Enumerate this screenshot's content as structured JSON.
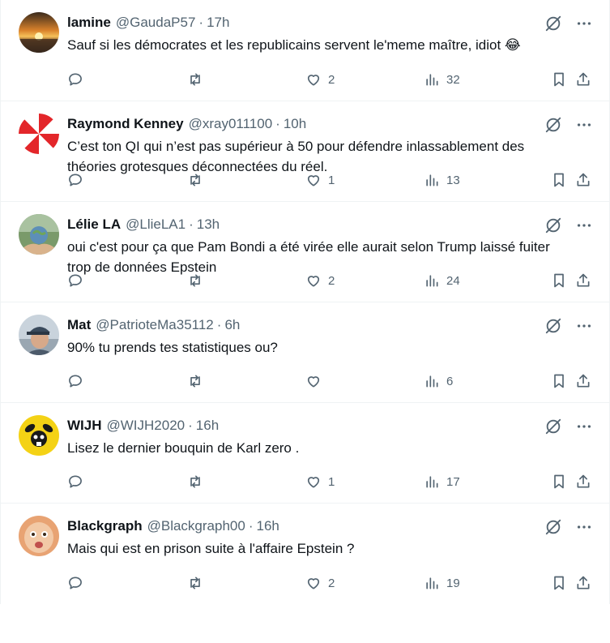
{
  "tweets": [
    {
      "name": "lamine",
      "handle": "@GaudaP57",
      "time": "17h",
      "text": "Sauf si les démocrates et les republicains servent le'meme maître, idiot 😂",
      "likes": "2",
      "views": "32",
      "avatar": "sunset"
    },
    {
      "name": "Raymond Kenney",
      "handle": "@xray011100",
      "time": "10h",
      "text": "C’est ton QI qui n’est pas supérieur à 50 pour défendre inlassablement des théories grotesques déconnectées du réel.",
      "likes": "1",
      "views": "13",
      "avatar": "umbrella"
    },
    {
      "name": "Lélie LA",
      "handle": "@LlieLA1",
      "time": "13h",
      "text": "oui c'est pour ça que Pam Bondi a été virée elle aurait selon Trump laissé fuiter trop de données Epstein",
      "likes": "2",
      "views": "24",
      "avatar": "globe-hands"
    },
    {
      "name": "Mat",
      "handle": "@PatrioteMa35112",
      "time": "6h",
      "text": "90% tu prends tes statistiques ou?",
      "likes": "",
      "views": "6",
      "avatar": "man-cap"
    },
    {
      "name": "WIJH",
      "handle": "@WIJH2020",
      "time": "16h",
      "text": "Lisez le dernier bouquin de Karl zero .",
      "likes": "1",
      "views": "17",
      "avatar": "yellow-rabbit"
    },
    {
      "name": "Blackgraph",
      "handle": "@Blackgraph00",
      "time": "16h",
      "text": "Mais qui est en prison suite à l'affaire Epstein ?",
      "likes": "2",
      "views": "19",
      "avatar": "baby-face"
    }
  ],
  "colors": {
    "text_primary": "#0f1419",
    "text_secondary": "#536471",
    "border": "#eff3f4"
  },
  "icons": [
    "reply-icon",
    "retweet-icon",
    "like-icon",
    "views-icon",
    "bookmark-icon",
    "share-icon",
    "grok-icon",
    "more-icon"
  ]
}
